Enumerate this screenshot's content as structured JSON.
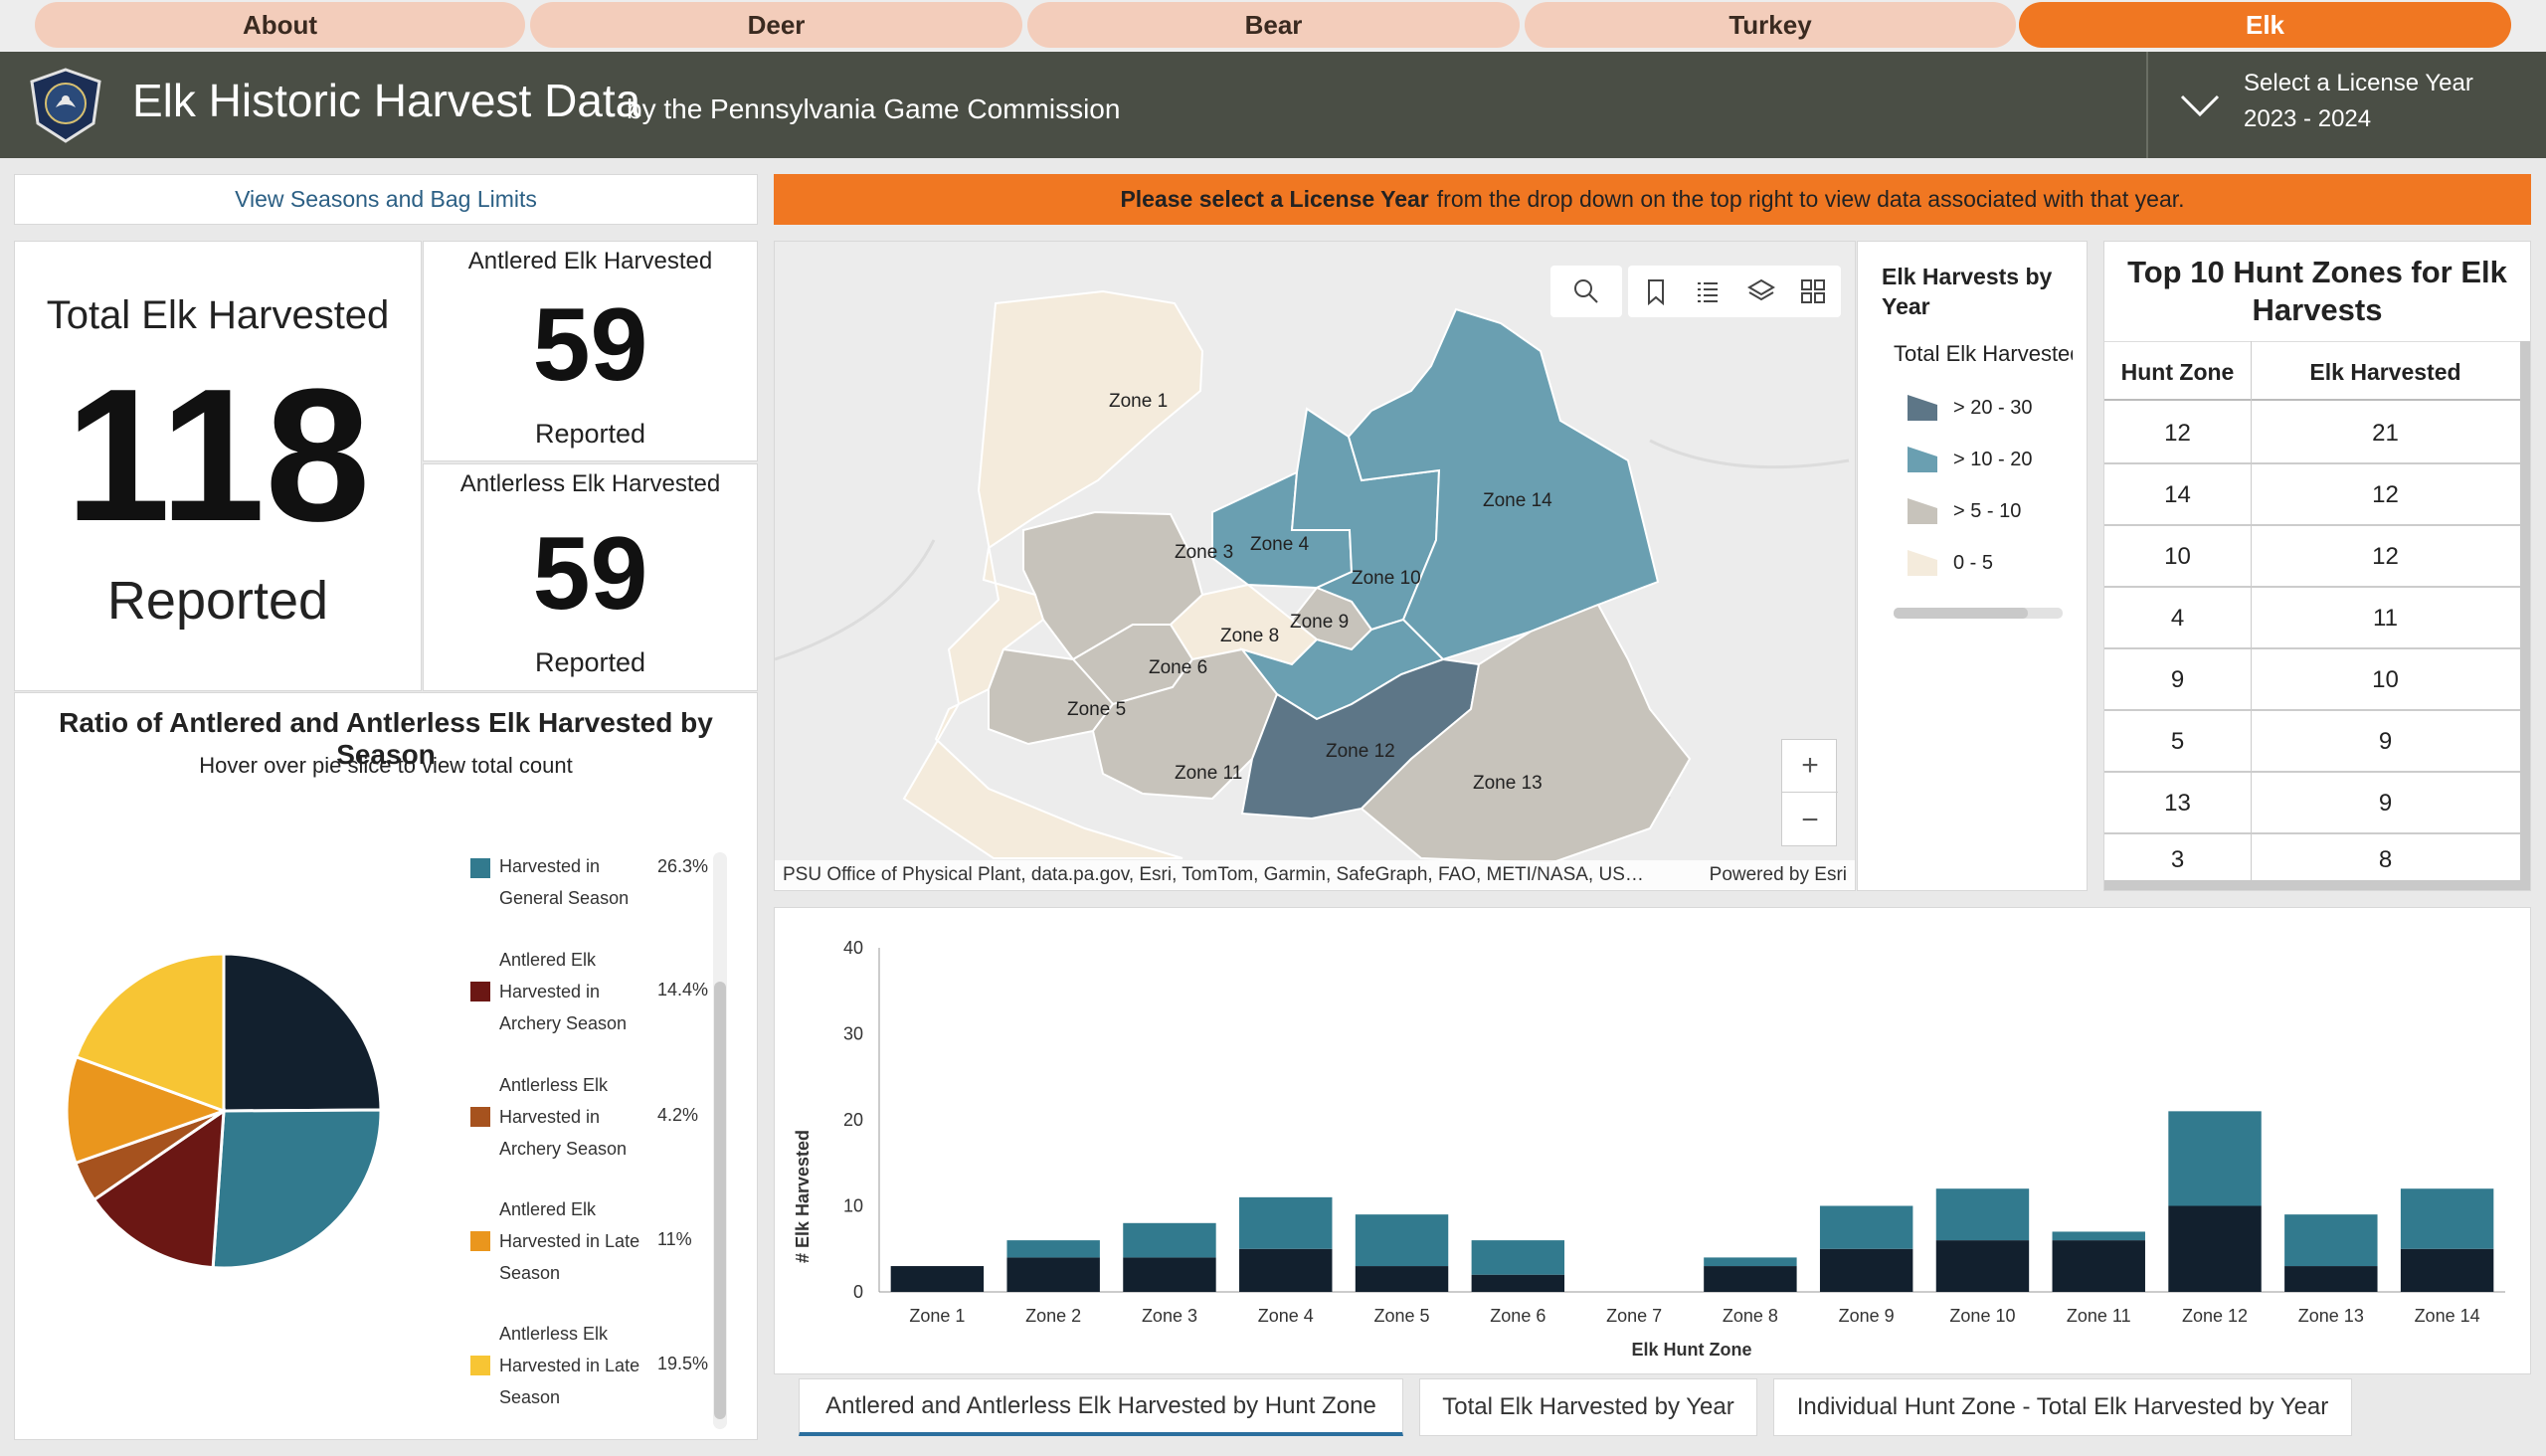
{
  "nav": {
    "tabs": [
      {
        "label": "About"
      },
      {
        "label": "Deer"
      },
      {
        "label": "Bear"
      },
      {
        "label": "Turkey"
      },
      {
        "label": "Elk",
        "active": true
      }
    ]
  },
  "header": {
    "title": "Elk Historic Harvest Data",
    "subtitle": "by the Pennsylvania Game Commission",
    "year_select": {
      "label": "Select a License Year",
      "value": "2023 - 2024"
    }
  },
  "seasons_link": "View Seasons and Bag Limits",
  "banner": {
    "bold": "Please select a License Year",
    "text": "from the drop down on the top right to view data associated with that year."
  },
  "kpi": {
    "total": {
      "title": "Total Elk Harvested",
      "value": "118",
      "caption": "Reported"
    },
    "antlered": {
      "title": "Antlered Elk Harvested",
      "value": "59",
      "caption": "Reported"
    },
    "antlerless": {
      "title": "Antlerless Elk Harvested",
      "value": "59",
      "caption": "Reported"
    }
  },
  "pie": {
    "title": "Ratio of Antlered and Antlerless Elk Harvested by Season",
    "subtitle": "Hover over pie slice to view total count"
  },
  "map": {
    "attribution": "PSU Office of Physical Plant, data.pa.gov, Esri, TomTom, Garmin, SafeGraph, FAO, METI/NASA, US…",
    "powered": "Powered by Esri",
    "zones": [
      "Zone 1",
      "Zone 3",
      "Zone 4",
      "Zone 10",
      "Zone 14",
      "Zone 9",
      "Zone 8",
      "Zone 6",
      "Zone 5",
      "Zone 11",
      "Zone 12",
      "Zone 13"
    ],
    "zoom_in": "+",
    "zoom_out": "−"
  },
  "map_legend": {
    "title": "Elk Harvests by Year",
    "field": "Total Elk Harvested",
    "classes": [
      {
        "label": "> 20 - 30",
        "color": "#5d7687"
      },
      {
        "label": "> 10 - 20",
        "color": "#6a9fb1"
      },
      {
        "label": "> 5 - 10",
        "color": "#c7c3bb"
      },
      {
        "label": "0 - 5",
        "color": "#f4ebdc"
      }
    ]
  },
  "top_table": {
    "title": "Top 10 Hunt Zones for Elk Harvests",
    "headers": [
      "Hunt Zone",
      "Elk Harvested"
    ],
    "rows": [
      [
        "12",
        "21"
      ],
      [
        "14",
        "12"
      ],
      [
        "10",
        "12"
      ],
      [
        "4",
        "11"
      ],
      [
        "9",
        "10"
      ],
      [
        "5",
        "9"
      ],
      [
        "13",
        "9"
      ],
      [
        "3",
        "8"
      ]
    ]
  },
  "chart_tabs": [
    {
      "label": "Antlered and Antlerless Elk Harvested by Hunt Zone",
      "active": true
    },
    {
      "label": "Total Elk Harvested by Year"
    },
    {
      "label": "Individual Hunt Zone - Total Elk Harvested by Year"
    }
  ],
  "chart_data": [
    {
      "type": "pie",
      "categories": [
        "Harvested in General Season",
        "Antlered Elk Harvested in Archery Season",
        "Antlerless Elk Harvested in Archery Season",
        "Antlered Elk Harvested in Late Season",
        "Antlerless Elk Harvested in Late Season"
      ],
      "values": [
        26.3,
        14.4,
        4.2,
        11,
        19.5
      ],
      "value_labels": [
        "26.3%",
        "14.4%",
        "4.2%",
        "11%",
        "19.5%"
      ],
      "slice_order": [
        {
          "label": "General Season (dark)",
          "value": 25,
          "color": "#12202e"
        },
        {
          "label": "Harvested in General Season",
          "value": 26.3,
          "color": "#327a8e"
        },
        {
          "label": "Antlered Elk Harvested in Archery Season",
          "value": 14.4,
          "color": "#6b1714"
        },
        {
          "label": "Antlerless Elk Harvested in Archery Season",
          "value": 4.2,
          "color": "#a6521e"
        },
        {
          "label": "Antlered Elk Harvested in Late Season",
          "value": 11,
          "color": "#ea961d"
        },
        {
          "label": "Antlerless Elk Harvested in Late Season",
          "value": 19.5,
          "color": "#f7c534"
        }
      ],
      "colors": [
        "#327a8e",
        "#6b1714",
        "#a6521e",
        "#ea961d",
        "#f7c534"
      ]
    },
    {
      "type": "bar",
      "stacked": true,
      "categories": [
        "Zone 1",
        "Zone 2",
        "Zone 3",
        "Zone 4",
        "Zone 5",
        "Zone 6",
        "Zone 7",
        "Zone 8",
        "Zone 9",
        "Zone 10",
        "Zone 11",
        "Zone 12",
        "Zone 13",
        "Zone 14"
      ],
      "series": [
        {
          "values": [
            3,
            4,
            4,
            5,
            3,
            2,
            0,
            3,
            5,
            6,
            6,
            10,
            3,
            5
          ],
          "color": "#12202e"
        },
        {
          "values": [
            0,
            2,
            4,
            6,
            6,
            4,
            0,
            1,
            5,
            6,
            1,
            11,
            6,
            7
          ],
          "color": "#327a8e"
        }
      ],
      "xlabel": "Elk Hunt Zone",
      "ylabel": "# Elk Harvested",
      "ylim": [
        0,
        40
      ],
      "yticks": [
        0,
        10,
        20,
        30,
        40
      ],
      "grid": false
    }
  ]
}
